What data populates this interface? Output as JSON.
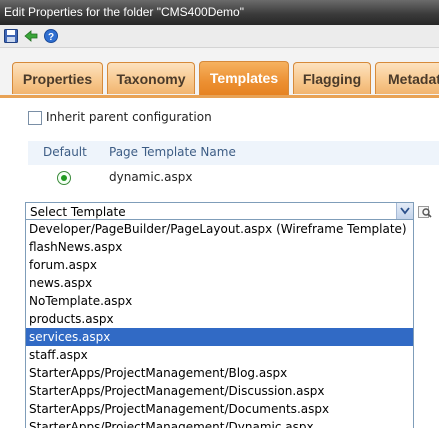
{
  "window": {
    "title": "Edit Properties for the folder \"CMS400Demo\""
  },
  "toolbar": {
    "buttons": [
      "save-icon",
      "back-icon",
      "help-icon"
    ]
  },
  "tabs": [
    {
      "label": "Properties",
      "active": false
    },
    {
      "label": "Taxonomy",
      "active": false
    },
    {
      "label": "Templates",
      "active": true
    },
    {
      "label": "Flagging",
      "active": false
    },
    {
      "label": "Metadat",
      "active": false
    }
  ],
  "inherit": {
    "label": "Inherit parent configuration",
    "checked": false
  },
  "table": {
    "col_default": "Default",
    "col_name": "Page Template Name",
    "rows": [
      {
        "name": "dynamic.aspx",
        "default": true
      }
    ]
  },
  "select": {
    "value": "Select Template",
    "options": [
      "Developer/PageBuilder/PageLayout.aspx (Wireframe Template)",
      "flashNews.aspx",
      "forum.aspx",
      "news.aspx",
      "NoTemplate.aspx",
      "products.aspx",
      "services.aspx",
      "staff.aspx",
      "StarterApps/ProjectManagement/Blog.aspx",
      "StarterApps/ProjectManagement/Discussion.aspx",
      "StarterApps/ProjectManagement/Documents.aspx",
      "StarterApps/ProjectManagement/Dynamic.aspx"
    ],
    "highlighted": "services.aspx"
  },
  "colors": {
    "accent": "#ec9032",
    "selection": "#316ac5",
    "header_bg": "#eef4fb"
  }
}
